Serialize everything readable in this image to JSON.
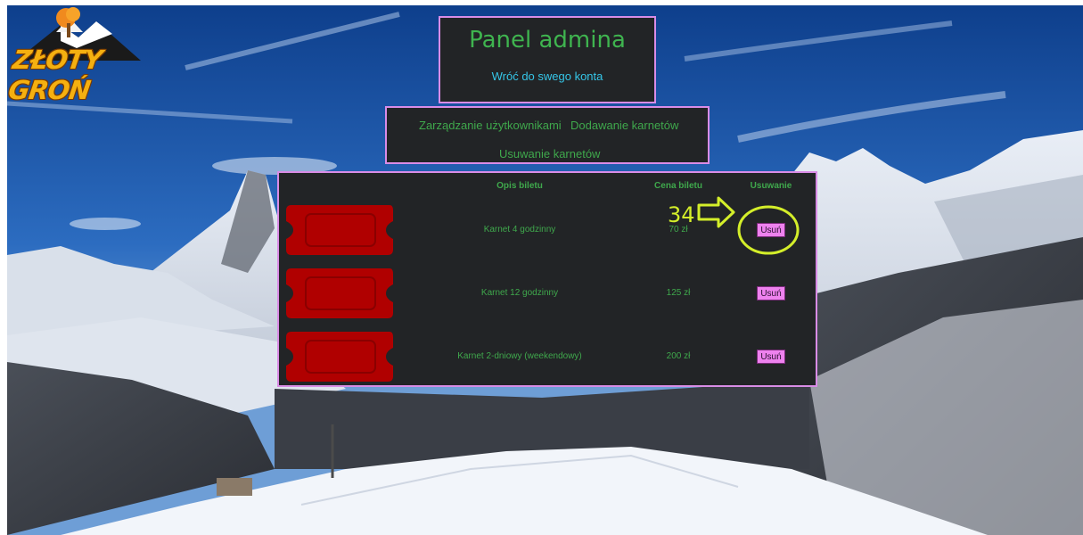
{
  "brand": {
    "logo_text": "ZŁOTY GROŃ"
  },
  "header": {
    "title": "Panel admina",
    "back_link": "Wróć do swego konta"
  },
  "nav": {
    "items": [
      {
        "label": "Zarządzanie użytkownikami"
      },
      {
        "label": "Dodawanie karnetów"
      },
      {
        "label": "Usuwanie karnetów"
      }
    ]
  },
  "table": {
    "headers": {
      "description": "Opis biletu",
      "price": "Cena biletu",
      "delete": "Usuwanie"
    },
    "rows": [
      {
        "description": "Karnet 4 godzinny",
        "price": "70 zł",
        "delete_label": "Usuń"
      },
      {
        "description": "Karnet 12 godzinny",
        "price": "125 zł",
        "delete_label": "Usuń"
      },
      {
        "description": "Karnet 2-dniowy (weekendowy)",
        "price": "200 zł",
        "delete_label": "Usuń"
      }
    ]
  },
  "annotation": {
    "step_number": "34"
  },
  "colors": {
    "accent_green": "#3fa84c",
    "link_cyan": "#35c6e8",
    "panel_border": "#d98ce6",
    "panel_bg": "#222426",
    "button_bg": "#ee82ee",
    "ticket_red": "#b00000",
    "annotation_yellow": "#d4ee2a"
  },
  "icons": {
    "ticket": "ticket-icon",
    "annotation_arrow": "arrow-right-icon"
  }
}
